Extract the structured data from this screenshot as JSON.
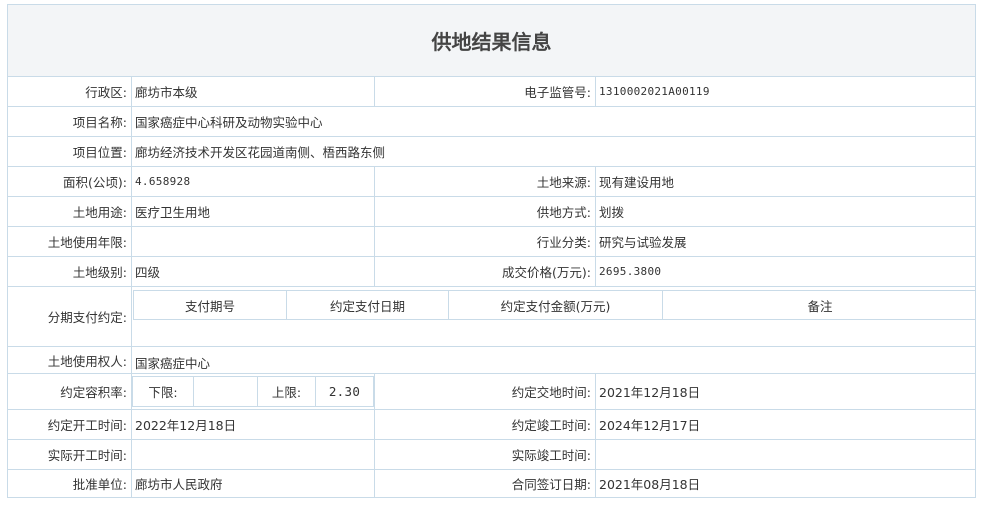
{
  "title": "供地结果信息",
  "rows": {
    "district": {
      "label": "行政区:",
      "value": "廊坊市本级"
    },
    "supervision_no": {
      "label": "电子监管号:",
      "value": "1310002021A00119"
    },
    "project_name": {
      "label": "项目名称:",
      "value": "国家癌症中心科研及动物实验中心"
    },
    "project_location": {
      "label": "项目位置:",
      "value": "廊坊经济技术开发区花园道南侧、梧西路东侧"
    },
    "area": {
      "label": "面积(公顷):",
      "value": "4.658928"
    },
    "land_source": {
      "label": "土地来源:",
      "value": "现有建设用地"
    },
    "land_use": {
      "label": "土地用途:",
      "value": "医疗卫生用地"
    },
    "supply_method": {
      "label": "供地方式:",
      "value": "划拨"
    },
    "use_term": {
      "label": "土地使用年限:",
      "value": ""
    },
    "industry": {
      "label": "行业分类:",
      "value": "研究与试验发展"
    },
    "land_grade": {
      "label": "土地级别:",
      "value": "四级"
    },
    "price": {
      "label": "成交价格(万元):",
      "value": "2695.3800"
    },
    "installments": {
      "label": "分期支付约定:",
      "headers": [
        "支付期号",
        "约定支付日期",
        "约定支付金额(万元)",
        "备注"
      ]
    },
    "land_user": {
      "label": "土地使用权人:",
      "value": "国家癌症中心"
    },
    "plot_ratio": {
      "label": "约定容积率:",
      "lower_label": "下限:",
      "lower_value": "",
      "upper_label": "上限:",
      "upper_value": "2.30"
    },
    "delivery_time": {
      "label": "约定交地时间:",
      "value": "2021年12月18日"
    },
    "start_time": {
      "label": "约定开工时间:",
      "value": "2022年12月18日"
    },
    "completion_time": {
      "label": "约定竣工时间:",
      "value": "2024年12月17日"
    },
    "actual_start": {
      "label": "实际开工时间:",
      "value": ""
    },
    "actual_completion": {
      "label": "实际竣工时间:",
      "value": ""
    },
    "approval_unit": {
      "label": "批准单位:",
      "value": "廊坊市人民政府"
    },
    "contract_date": {
      "label": "合同签订日期:",
      "value": "2021年08月18日"
    }
  },
  "colors": {
    "border": "#c9dbe8",
    "title_bg": "#f3f5f7",
    "text": "#333333"
  }
}
